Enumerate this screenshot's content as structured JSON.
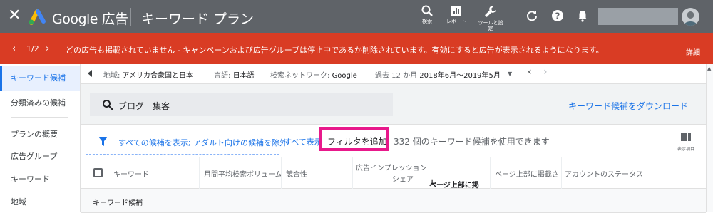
{
  "app": {
    "brand": "Google 広告",
    "page_title": "キーワード プラン",
    "toolbar": [
      {
        "label": "検索",
        "icon": "search-icon"
      },
      {
        "label": "レポート",
        "icon": "reports-icon"
      },
      {
        "label": "ツールと設定",
        "icon": "wrench-icon"
      }
    ]
  },
  "alert": {
    "counter": "1/2",
    "message": "どの広告も掲載されていません - キャンペーンおよび広告グループは停止中であるか削除されています。有効にすると広告が表示されるようになります。",
    "detail": "詳細",
    "color": "#d93c24"
  },
  "sidebar": {
    "items": [
      {
        "label": "キーワード候補",
        "active": true
      },
      {
        "label": "分類済みの候補"
      },
      {
        "label": "プランの概要"
      },
      {
        "label": "広告グループ"
      },
      {
        "label": "キーワード"
      },
      {
        "label": "地域"
      }
    ]
  },
  "crumbs": {
    "location_label": "地域:",
    "location_value": "アメリカ合衆国と日本",
    "language_label": "言語:",
    "language_value": "日本語",
    "network_label": "検索ネットワーク:",
    "network_value": "Google",
    "period_label": "過去 12 か月",
    "period_value": "2018年6月〜2019年5月"
  },
  "search": {
    "value": "ブログ　集客"
  },
  "download_link": "キーワード候補をダウンロード",
  "filter": {
    "chip_text": "すべての候補を表示; アダルト向けの候補を除外",
    "show_all": "すべて表示",
    "add_filter": "フィルタを追加",
    "count_text": "332 個のキーワード候補を使用できます",
    "columns_label": "表示項目"
  },
  "table": {
    "headers": [
      "キーワード",
      "月間平均検索ボリューム",
      "競合性",
      "広告インプレッション",
      "シェア",
      "ページ上部に掲",
      "ページ上部に掲載さ",
      "アカウントのステータス"
    ],
    "group_label": "キーワード候補"
  },
  "colors": {
    "topbar": "#5f6368",
    "accent": "#1a73e8",
    "highlight": "#e8198b"
  }
}
